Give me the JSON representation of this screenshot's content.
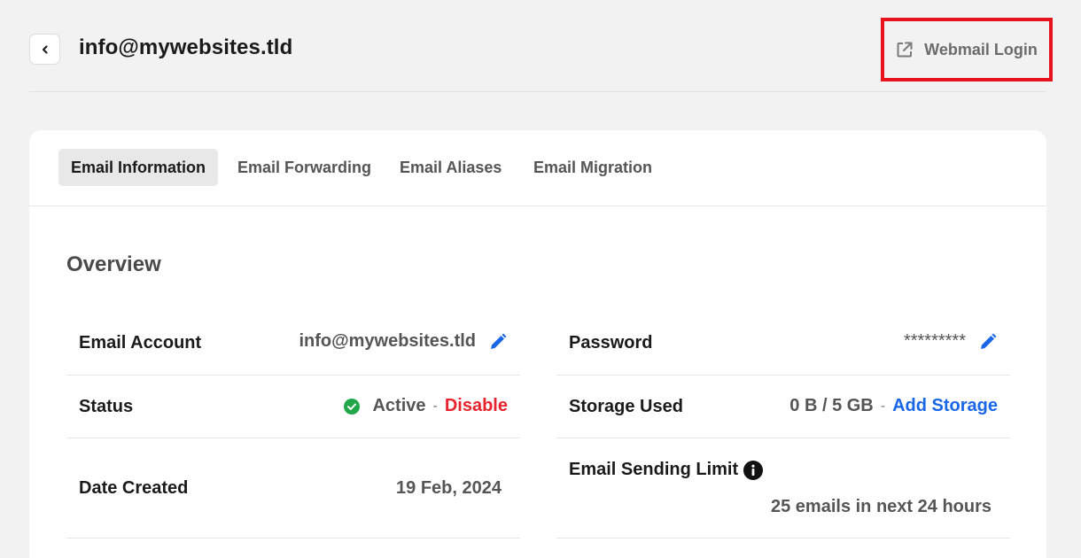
{
  "header": {
    "title": "info@mywebsites.tld",
    "back_icon": "chevron-left-icon",
    "webmail_label": "Webmail Login",
    "webmail_icon": "external-link-icon"
  },
  "tabs": [
    {
      "label": "Email Information",
      "active": true
    },
    {
      "label": "Email Forwarding",
      "active": false
    },
    {
      "label": "Email Aliases",
      "active": false
    },
    {
      "label": "Email Migration",
      "active": false
    }
  ],
  "overview": {
    "title": "Overview",
    "email_account": {
      "label": "Email Account",
      "value": "info@mywebsites.tld"
    },
    "password": {
      "label": "Password",
      "value": "*********"
    },
    "status": {
      "label": "Status",
      "value": "Active",
      "separator": "-",
      "action": "Disable"
    },
    "storage": {
      "label": "Storage Used",
      "value": "0 B / 5 GB",
      "separator": "-",
      "action": "Add Storage"
    },
    "date_created": {
      "label": "Date Created",
      "value": "19 Feb, 2024"
    },
    "sending_limit": {
      "label": "Email Sending Limit",
      "value": "25 emails in next 24 hours"
    }
  },
  "colors": {
    "accent": "#1a66e8",
    "danger": "#e8232e",
    "success": "#22a64a",
    "highlight": "#e8131c"
  }
}
